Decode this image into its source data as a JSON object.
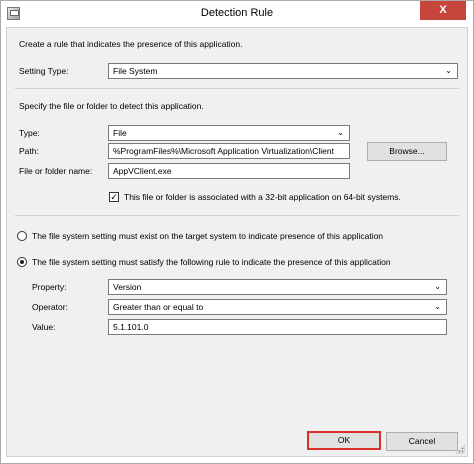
{
  "window": {
    "title": "Detection Rule",
    "close_label": "X"
  },
  "intro": "Create a rule that indicates the presence of this application.",
  "setting_type": {
    "label": "Setting Type:",
    "value": "File System"
  },
  "specify_text": "Specify the file or folder to detect this application.",
  "type": {
    "label": "Type:",
    "value": "File"
  },
  "path": {
    "label": "Path:",
    "value": "%ProgramFiles%\\Microsoft Application Virtualization\\Client",
    "browse_label": "Browse..."
  },
  "file_name": {
    "label": "File or folder name:",
    "value": "AppVClient.exe"
  },
  "bit32_checkbox": {
    "label": "This file or folder is associated with a 32-bit application on 64-bit systems.",
    "checked": true,
    "mark": "✓"
  },
  "radio_exist": {
    "label": "The file system setting must exist on the target system to indicate presence of this application",
    "checked": false
  },
  "radio_rule": {
    "label": "The file system setting must satisfy the following rule to indicate the presence of this application",
    "checked": true
  },
  "property": {
    "label": "Property:",
    "value": "Version"
  },
  "operator": {
    "label": "Operator:",
    "value": "Greater than or equal to"
  },
  "value": {
    "label": "Value:",
    "value": "5.1.101.0"
  },
  "buttons": {
    "ok": "OK",
    "cancel": "Cancel"
  },
  "colors": {
    "close": "#c7463c",
    "highlight": "#d9302b",
    "dialog_bg": "#f0f0f0"
  }
}
